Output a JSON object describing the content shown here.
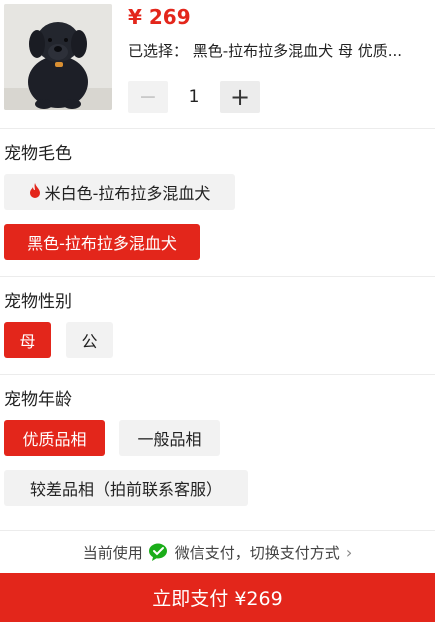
{
  "product": {
    "price": "¥ 269",
    "selected_text": "已选择： 黑色-拉布拉多混血犬 母 优质..."
  },
  "quantity": {
    "minus_symbol": "−",
    "value": "1",
    "plus_symbol": "+"
  },
  "options": {
    "color": {
      "title": "宠物毛色",
      "items": [
        {
          "label": "米白色-拉布拉多混血犬",
          "selected": false,
          "icon": "fire-icon"
        },
        {
          "label": "黑色-拉布拉多混血犬",
          "selected": true
        }
      ]
    },
    "gender": {
      "title": "宠物性别",
      "items": [
        {
          "label": "母",
          "selected": true
        },
        {
          "label": "公",
          "selected": false
        }
      ]
    },
    "grade": {
      "title": "宠物年龄",
      "items": [
        {
          "label": "优质品相",
          "selected": true
        },
        {
          "label": "一般品相",
          "selected": false
        },
        {
          "label": "较差品相（拍前联系客服）",
          "selected": false
        }
      ]
    }
  },
  "payment": {
    "prefix": "当前使用",
    "method": "微信支付，切换支付方式",
    "chevron": "›",
    "pay_button_label": "立即支付 ¥269"
  },
  "colors": {
    "accent": "#e3261b",
    "chip_bg": "#f2f2f2",
    "wechat_green": "#1aad19"
  }
}
